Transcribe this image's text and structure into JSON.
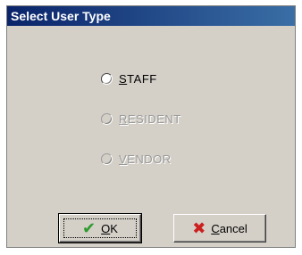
{
  "window": {
    "title": "Select User Type"
  },
  "options": [
    {
      "accel": "S",
      "rest": "TAFF",
      "enabled": true
    },
    {
      "accel": "R",
      "rest": "ESIDENT",
      "enabled": false
    },
    {
      "accel": "V",
      "rest": "ENDOR",
      "enabled": false
    }
  ],
  "buttons": {
    "ok": {
      "accel": "O",
      "rest": "K",
      "icon": "checkmark-icon",
      "icon_color": "#2e9b2e"
    },
    "cancel": {
      "accel": "C",
      "rest": "ancel",
      "icon": "x-icon",
      "icon_color": "#cc1f1f"
    }
  }
}
